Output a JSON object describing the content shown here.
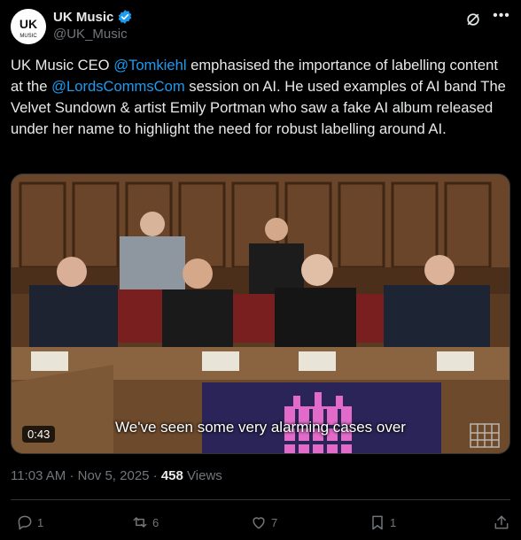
{
  "account": {
    "name": "UK Music",
    "handle": "@UK_Music",
    "verified": true,
    "avatar_text": "UK MUSIC"
  },
  "tweet": {
    "text_parts": [
      {
        "text": "UK Music CEO ",
        "type": "plain"
      },
      {
        "text": "@Tomkiehl",
        "type": "mention"
      },
      {
        "text": " emphasised the importance of labelling content at the ",
        "type": "plain"
      },
      {
        "text": "@LordsCommsCom",
        "type": "mention"
      },
      {
        "text": " session on AI. He used examples of AI band The Velvet Sundown & artist Emily Portman who saw a fake AI album released under her name to highlight the need for robust labelling around AI.",
        "type": "plain"
      }
    ]
  },
  "media": {
    "duration": "0:43",
    "caption": "We've seen some very alarming cases over"
  },
  "meta": {
    "time": "11:03 AM",
    "date": "Nov 5, 2025",
    "views_count": "458",
    "views_label": "Views"
  },
  "actions": {
    "replies": "1",
    "reposts": "6",
    "likes": "7",
    "bookmarks": "1"
  },
  "colors": {
    "background": "#000000",
    "accent": "#1d9bf0",
    "muted": "#71767b",
    "text": "#e7e9ea",
    "verified": "#1d9bf0"
  },
  "icons": [
    "grok-icon",
    "more-icon",
    "verified-badge-icon",
    "reply-icon",
    "repost-icon",
    "like-icon",
    "bookmark-icon",
    "share-icon",
    "parliament-portcullis-icon"
  ]
}
